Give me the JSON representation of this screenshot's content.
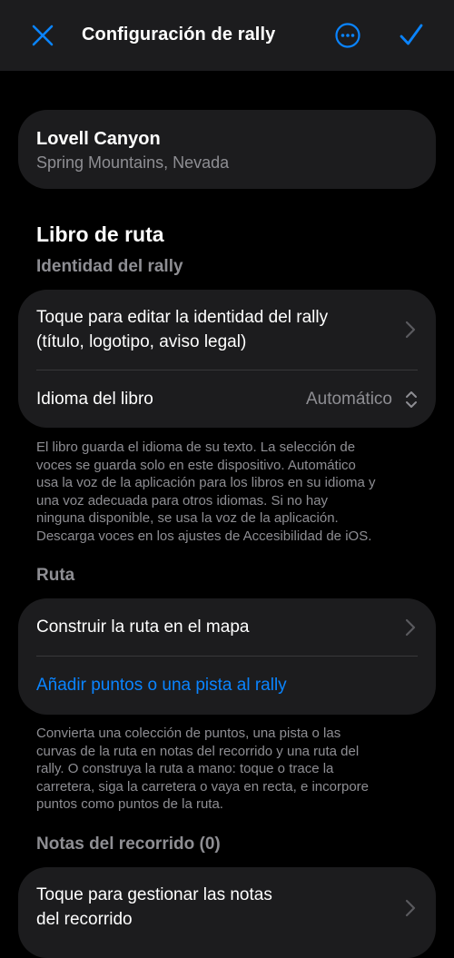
{
  "nav": {
    "title": "Configuración de rally",
    "close_icon": "close-icon",
    "more_icon": "ellipsis-circle-icon",
    "done_icon": "checkmark-icon",
    "accent": "#0a84ff"
  },
  "location": {
    "name": "Lovell Canyon",
    "region": "Spring Mountains, Nevada"
  },
  "roadbook": {
    "title": "Libro de ruta",
    "identity_header": "Identidad del rally",
    "edit_identity_line1": "Toque para editar la identidad del rally",
    "edit_identity_line2": "(título, logotipo, aviso legal)",
    "language_label": "Idioma del libro",
    "language_value": "Automático",
    "language_note": [
      "El libro guarda el idioma de su texto. La selección de",
      "voces se guarda solo en este dispositivo. Automático",
      "usa la voz de la aplicación para los libros en su idioma y",
      "una voz adecuada para otros idiomas. Si no hay",
      "ninguna disponible, se usa la voz de la aplicación.",
      "Descarga voces en los ajustes de Accesibilidad de iOS."
    ]
  },
  "route": {
    "header": "Ruta",
    "build_label": "Construir la ruta en el mapa",
    "add_label": "Añadir puntos o una pista al rally",
    "note": [
      "Convierta una colección de puntos, una pista o las",
      "curvas de la ruta en notas del recorrido y una ruta del",
      "rally. O construya la ruta a mano: toque o trace la",
      "carretera, siga la carretera o vaya en recta, e incorpore",
      "puntos como puntos de la ruta."
    ]
  },
  "notes": {
    "header": "Notas del recorrido (0)",
    "manage_line1": "Toque para gestionar las notas",
    "manage_line2": "del recorrido"
  }
}
